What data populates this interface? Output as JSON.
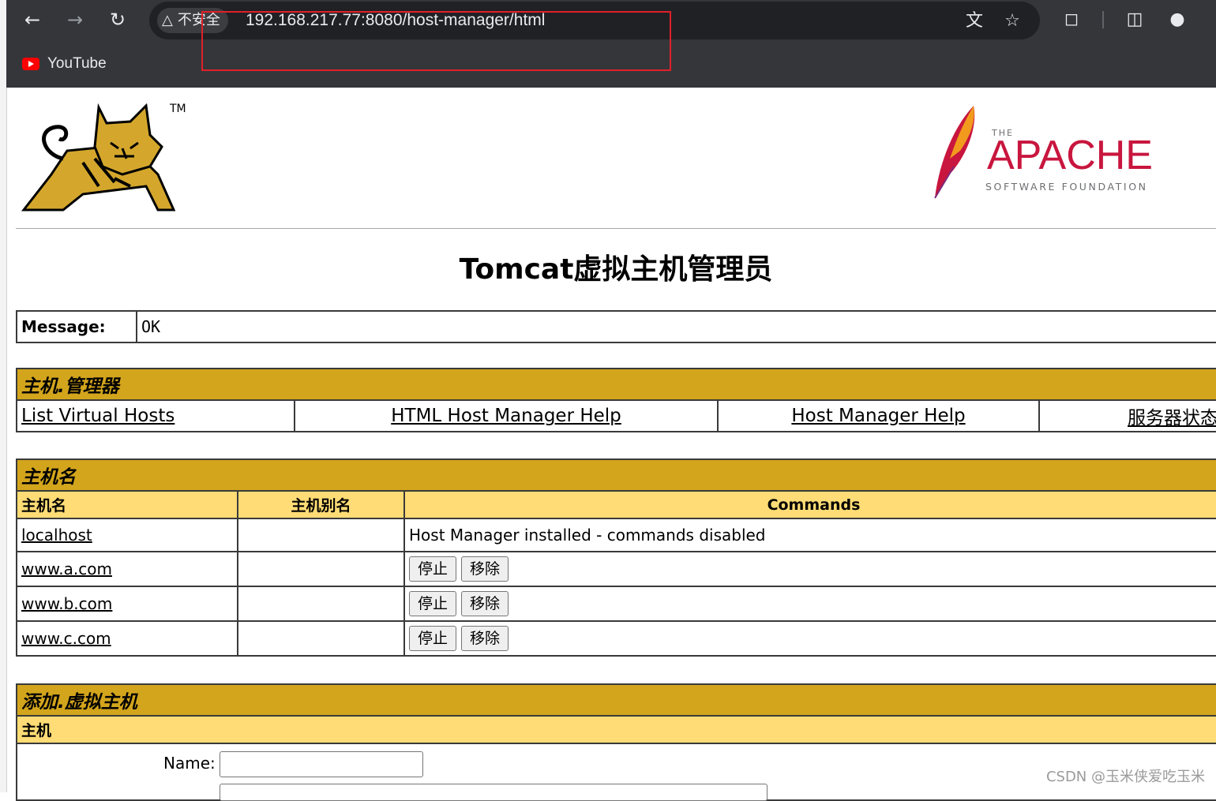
{
  "browser": {
    "security_label": "不安全",
    "url": "192.168.217.77:8080/host-manager/html",
    "bookmark_label": "YouTube"
  },
  "logos": {
    "tomcat_tm": "TM",
    "apache_the": "THE",
    "apache_name": "APACHE",
    "apache_sub": "SOFTWARE FOUNDATION"
  },
  "page_title": "Tomcat虚拟主机管理员",
  "message": {
    "label": "Message:",
    "value": "OK"
  },
  "manager": {
    "title": "主机.管理器",
    "links": [
      "List Virtual Hosts",
      "HTML Host Manager Help",
      "Host Manager Help",
      "服务器状态"
    ]
  },
  "hosts": {
    "title": "主机名",
    "columns": [
      "主机名",
      "主机别名",
      "Commands"
    ],
    "rows": [
      {
        "name": "localhost",
        "alias": "",
        "note": "Host Manager installed - commands disabled"
      },
      {
        "name": "www.a.com",
        "alias": ""
      },
      {
        "name": "www.b.com",
        "alias": ""
      },
      {
        "name": "www.c.com",
        "alias": ""
      }
    ],
    "stop_label": "停止",
    "remove_label": "移除"
  },
  "add_host": {
    "title": "添加.虚拟主机",
    "section": "主机",
    "name_label": "Name:",
    "name_value": ""
  },
  "watermark": "CSDN @玉米侠爱吃玉米",
  "colors": {
    "title_bg": "#d3a51c",
    "header_bg": "#ffdc75",
    "chrome_bg": "#35363a"
  }
}
